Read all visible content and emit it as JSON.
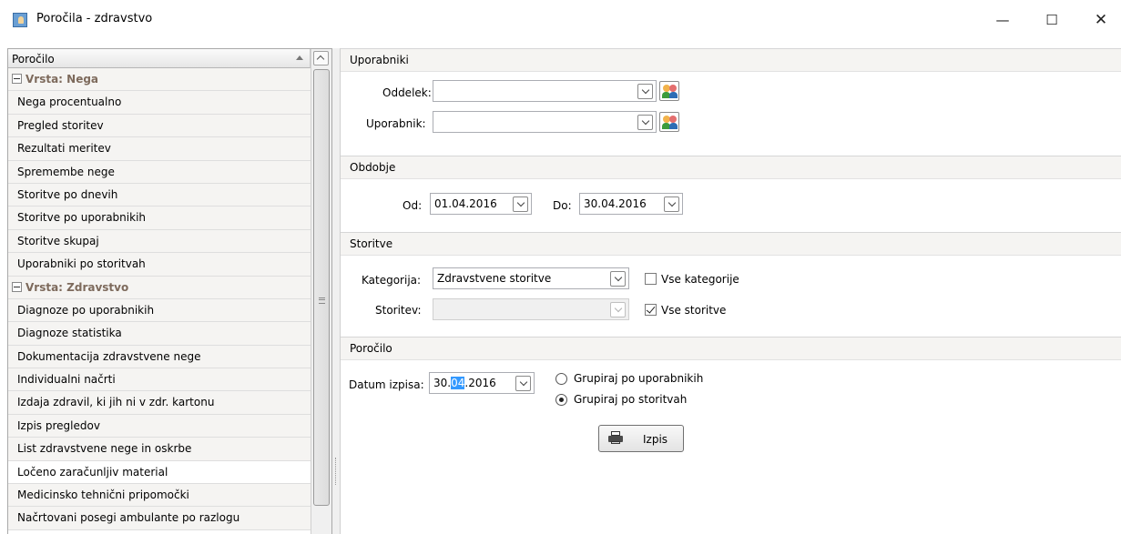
{
  "window": {
    "title": "Poročila - zdravstvo",
    "minimize_glyph": "—",
    "maximize_glyph": "☐",
    "close_glyph": "✕"
  },
  "report_list": {
    "header": "Poročilo",
    "groups": [
      {
        "label": "Vrsta: Nega",
        "items": [
          "Nega procentualno",
          "Pregled storitev",
          "Rezultati meritev",
          "Spremembe nege",
          "Storitve po dnevih",
          "Storitve po uporabnikih",
          "Storitve skupaj",
          "Uporabniki po storitvah"
        ]
      },
      {
        "label": "Vrsta: Zdravstvo",
        "items": [
          "Diagnoze po uporabnikih",
          "Diagnoze statistika",
          "Dokumentacija zdravstvene nege",
          "Individualni načrti",
          "Izdaja zdravil, ki jih ni v zdr. kartonu",
          "Izpis pregledov",
          "List zdravstvene nege in oskrbe",
          "Ločeno zaračunljiv material",
          "Medicinsko tehnični pripomočki",
          "Načrtovani posegi ambulante po razlogu"
        ]
      }
    ],
    "selected": "Ločeno zaračunljiv material"
  },
  "uporabniki": {
    "section": "Uporabniki",
    "oddelek_label": "Oddelek:",
    "oddelek_value": "",
    "uporabnik_label": "Uporabnik:",
    "uporabnik_value": ""
  },
  "obdobje": {
    "section": "Obdobje",
    "od_label": "Od:",
    "od_value": "01.04.2016",
    "do_label": "Do:",
    "do_value": "30.04.2016"
  },
  "storitve": {
    "section": "Storitve",
    "kategorija_label": "Kategorija:",
    "kategorija_value": "Zdravstvene storitve",
    "vse_kategorije_label": "Vse kategorije",
    "vse_kategorije_checked": false,
    "storitev_label": "Storitev:",
    "storitev_value": "",
    "vse_storitve_label": "Vse storitve",
    "vse_storitve_checked": true
  },
  "porocilo": {
    "section": "Poročilo",
    "datum_label": "Datum izpisa:",
    "datum_day": "30.",
    "datum_month_selected": "04",
    "datum_year": ".2016",
    "group_by_users_label": "Grupiraj po uporabnikih",
    "group_by_services_label": "Grupiraj po storitvah",
    "group_by_selected": "services",
    "print_label": "Izpis",
    "print_icon": "printer-icon"
  }
}
